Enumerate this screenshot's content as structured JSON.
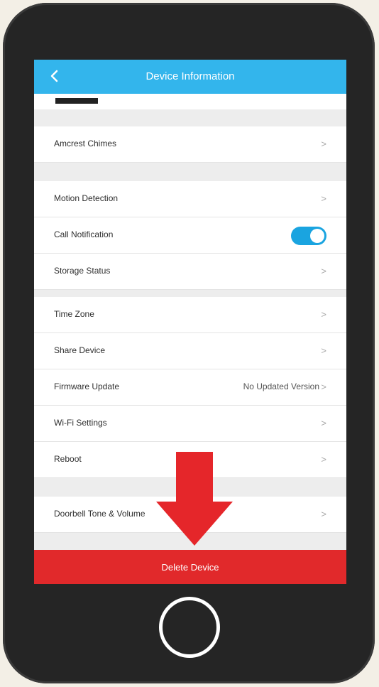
{
  "header": {
    "title": "Device Information",
    "back_icon": "chevron-left-icon"
  },
  "rows": {
    "amcrest_chimes": "Amcrest Chimes",
    "motion_detection": "Motion Detection",
    "call_notification": "Call Notification",
    "storage_status": "Storage Status",
    "time_zone": "Time Zone",
    "share_device": "Share Device",
    "firmware_update": "Firmware Update",
    "firmware_value": "No Updated Version",
    "wifi_settings": "Wi-Fi Settings",
    "reboot": "Reboot",
    "doorbell_tone": "Doorbell Tone & Volume"
  },
  "chevron": ">",
  "delete": {
    "label": "Delete Device"
  },
  "colors": {
    "header": "#33b5ec",
    "toggle": "#1aa4e0",
    "delete": "#e1292b",
    "arrow": "#e5262a"
  },
  "call_notification_enabled": true
}
